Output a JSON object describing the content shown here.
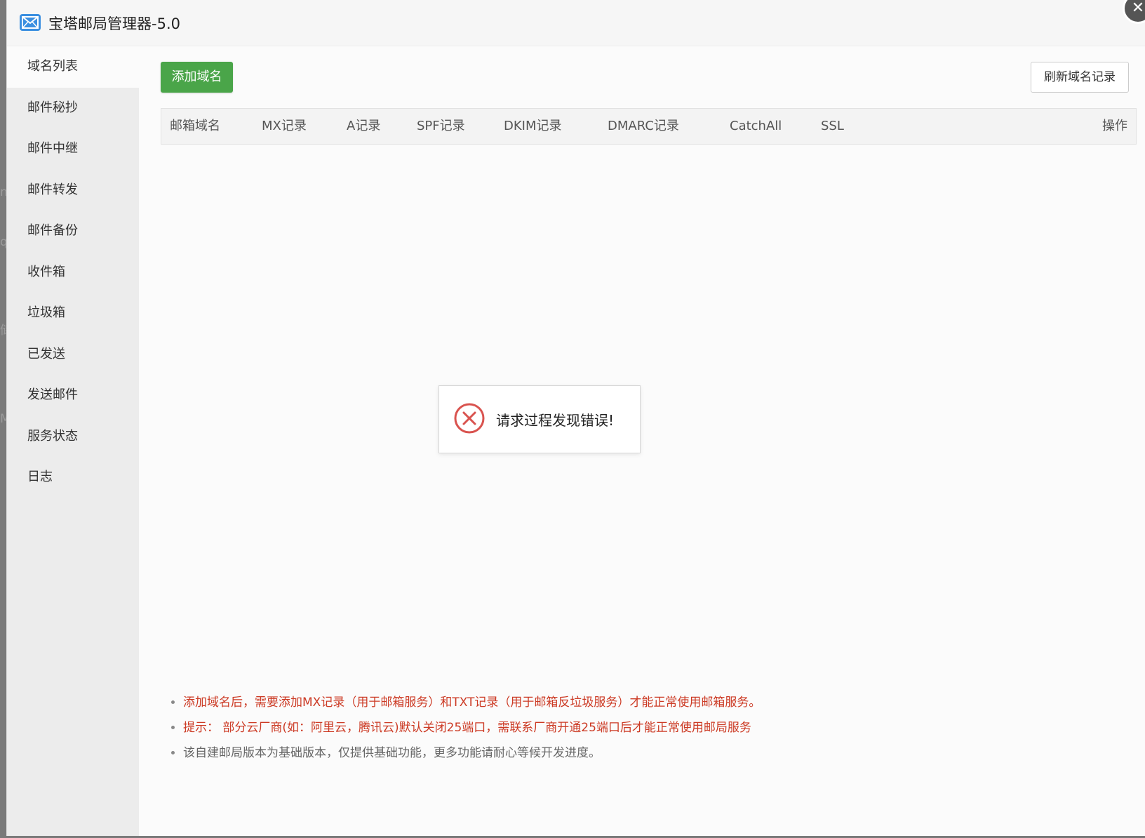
{
  "window": {
    "title": "宝塔邮局管理器-5.0",
    "close_glyph": "✕",
    "icon": "mail-icon"
  },
  "sidebar": {
    "items": [
      {
        "label": "域名列表",
        "active": true
      },
      {
        "label": "邮件秘抄"
      },
      {
        "label": "邮件中继"
      },
      {
        "label": "邮件转发"
      },
      {
        "label": "邮件备份"
      },
      {
        "label": "收件箱"
      },
      {
        "label": "垃圾箱"
      },
      {
        "label": "已发送"
      },
      {
        "label": "发送邮件"
      },
      {
        "label": "服务状态"
      },
      {
        "label": "日志"
      }
    ]
  },
  "toolbar": {
    "add_label": "添加域名",
    "refresh_label": "刷新域名记录",
    "add_color": "#4aa549"
  },
  "table": {
    "columns": [
      "邮箱域名",
      "MX记录",
      "A记录",
      "SPF记录",
      "DKIM记录",
      "DMARC记录",
      "CatchAll",
      "SSL",
      "操作"
    ],
    "rows": []
  },
  "error": {
    "message": "请求过程发现错误!",
    "icon": "error-x-icon",
    "color": "#d9534f"
  },
  "tips": [
    {
      "text": "添加域名后，需要添加MX记录（用于邮箱服务）和TXT记录（用于邮箱反垃圾服务）才能正常使用邮箱服务。",
      "style": "red"
    },
    {
      "text": "提示： 部分云厂商(如：阿里云，腾讯云)默认关闭25端口，需联系厂商开通25端口后才能正常使用邮局服务",
      "style": "red"
    },
    {
      "text": "该自建邮局版本为基础版本，仅提供基础功能，更多功能请耐心等候开发进度。",
      "style": "normal"
    }
  ]
}
